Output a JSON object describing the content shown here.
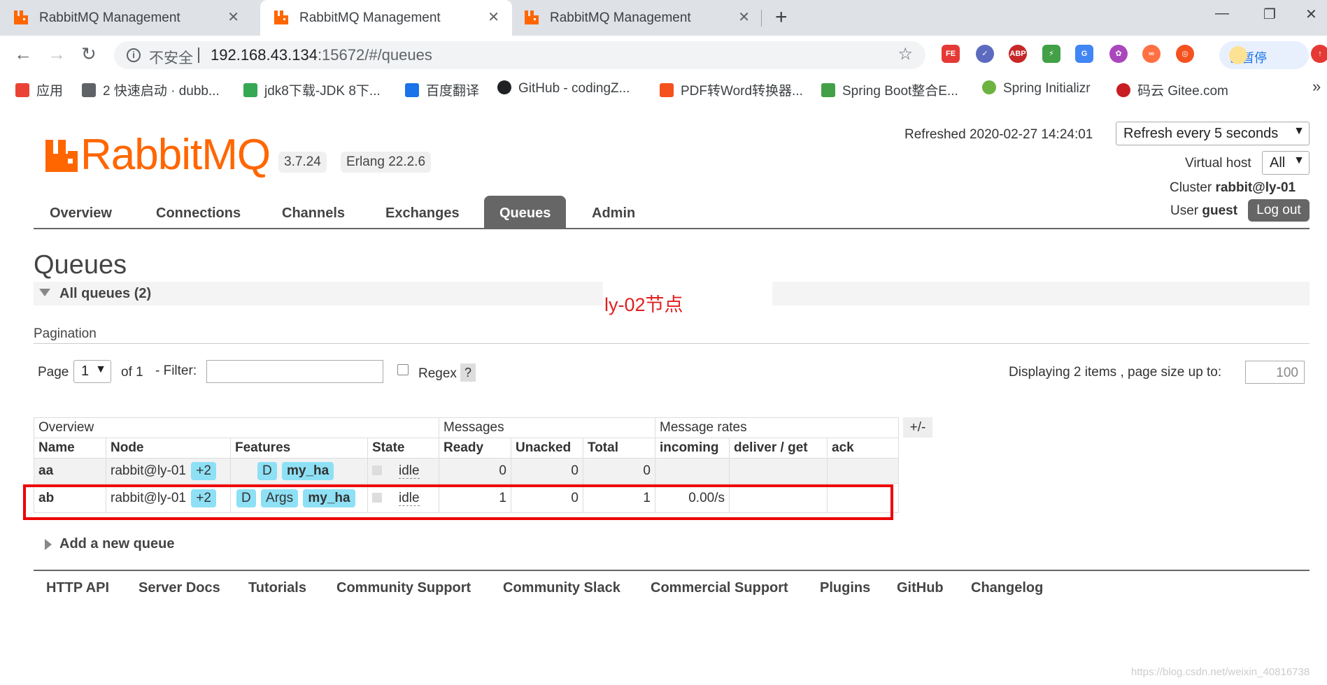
{
  "browser": {
    "tabs": [
      {
        "title": "RabbitMQ Management",
        "active": false
      },
      {
        "title": "RabbitMQ Management",
        "active": true
      },
      {
        "title": "RabbitMQ Management",
        "active": false
      }
    ],
    "address": {
      "security_label": "不安全",
      "host": "192.168.43.134",
      "rest": ":15672/#/queues"
    },
    "paused_label": "已暂停",
    "bookmarks": [
      {
        "label": "应用",
        "color": "#ea4335"
      },
      {
        "label": "2 快速启动 · dubb...",
        "color": "#5f6368"
      },
      {
        "label": "jdk8下载-JDK 8下...",
        "color": "#34a853"
      },
      {
        "label": "百度翻译",
        "color": "#1a73e8"
      },
      {
        "label": "GitHub - codingZ...",
        "color": "#202124"
      },
      {
        "label": "PDF转Word转换器...",
        "color": "#f4511e"
      },
      {
        "label": "Spring Boot整合E...",
        "color": "#43a047"
      },
      {
        "label": "Spring Initializr",
        "color": "#6db33f"
      },
      {
        "label": "码云 Gitee.com",
        "color": "#c71d23"
      }
    ]
  },
  "header": {
    "logo_text": "RabbitMQ",
    "version": "3.7.24",
    "erlang": "Erlang 22.2.6",
    "refreshed": "Refreshed 2020-02-27 14:24:01",
    "refresh_select": "Refresh every 5 seconds",
    "vhost_label": "Virtual host",
    "vhost_value": "All",
    "cluster_label": "Cluster",
    "cluster_value": "rabbit@ly-01",
    "user_label": "User",
    "user_value": "guest",
    "logout": "Log out"
  },
  "nav": [
    "Overview",
    "Connections",
    "Channels",
    "Exchanges",
    "Queues",
    "Admin"
  ],
  "page": {
    "title": "Queues",
    "all_queues": "All queues (2)",
    "annotation": "ly-02节点",
    "pagination": "Pagination",
    "page_label": "Page",
    "page_value": "1",
    "of_label": "of 1",
    "filter_label": "- Filter:",
    "regex_label": "Regex",
    "help": "?",
    "displaying": "Displaying 2 items , page size up to:",
    "page_size": "100",
    "plus_minus": "+/-",
    "add_queue": "Add a new queue"
  },
  "table": {
    "groups": [
      "Overview",
      "Messages",
      "Message rates"
    ],
    "columns": [
      "Name",
      "Node",
      "Features",
      "State",
      "Ready",
      "Unacked",
      "Total",
      "incoming",
      "deliver / get",
      "ack"
    ],
    "rows": [
      {
        "name": "aa",
        "node": "rabbit@ly-01",
        "node_extra": "+2",
        "features": [
          "D"
        ],
        "policy": "my_ha",
        "state": "idle",
        "ready": "0",
        "unacked": "0",
        "total": "0",
        "incoming": "",
        "deliver": "",
        "ack": ""
      },
      {
        "name": "ab",
        "node": "rabbit@ly-01",
        "node_extra": "+2",
        "features": [
          "D",
          "Args"
        ],
        "policy": "my_ha",
        "state": "idle",
        "ready": "1",
        "unacked": "0",
        "total": "1",
        "incoming": "0.00/s",
        "deliver": "",
        "ack": ""
      }
    ]
  },
  "footer": [
    "HTTP API",
    "Server Docs",
    "Tutorials",
    "Community Support",
    "Community Slack",
    "Commercial Support",
    "Plugins",
    "GitHub",
    "Changelog"
  ],
  "watermark": "https://blog.csdn.net/weixin_40816738",
  "colors": {
    "brand": "#ff6600",
    "pill": "#8ee0f5",
    "highlight": "#ee0000"
  }
}
